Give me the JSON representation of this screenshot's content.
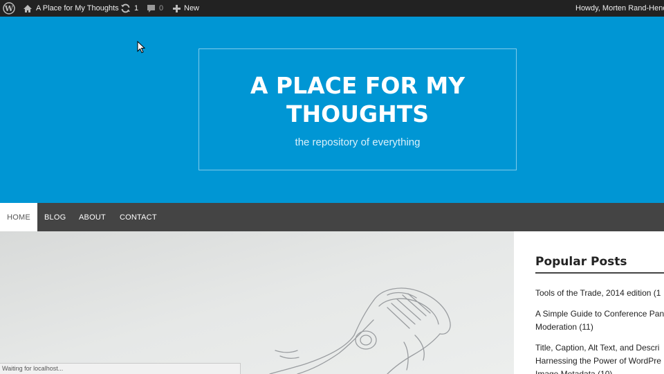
{
  "admin_bar": {
    "site_name": "A Place for My Thoughts",
    "updates_count": "1",
    "comments_count": "0",
    "new_label": "New",
    "howdy": "Howdy, Morten Rand-Hendr"
  },
  "header": {
    "title_line1": "A PLACE FOR MY",
    "title_line2": "THOUGHTS",
    "description": "the repository of everything"
  },
  "nav": {
    "items": [
      {
        "label": "HOME",
        "active": true
      },
      {
        "label": "BLOG"
      },
      {
        "label": "ABOUT"
      },
      {
        "label": "CONTACT"
      }
    ]
  },
  "sidebar": {
    "widget_title": "Popular Posts",
    "posts": [
      {
        "line1": "Tools of the Trade, 2014 edition (1"
      },
      {
        "line1": "A Simple Guide to Conference Pan",
        "line2": "Moderation (11)"
      },
      {
        "line1": "Title, Caption, Alt Text, and Descri",
        "line2": "Harnessing the Power of WordPre",
        "line3": "Image Metadata (10)"
      }
    ]
  },
  "status_bar": {
    "text": "Waiting for localhost..."
  },
  "colors": {
    "header_bg": "#0096d4",
    "admin_bar_bg": "#222222",
    "nav_bg": "#444444"
  },
  "icons": [
    "wordpress-logo-icon",
    "home-icon",
    "updates-icon",
    "comment-icon",
    "plus-icon",
    "mouse-cursor-icon"
  ]
}
